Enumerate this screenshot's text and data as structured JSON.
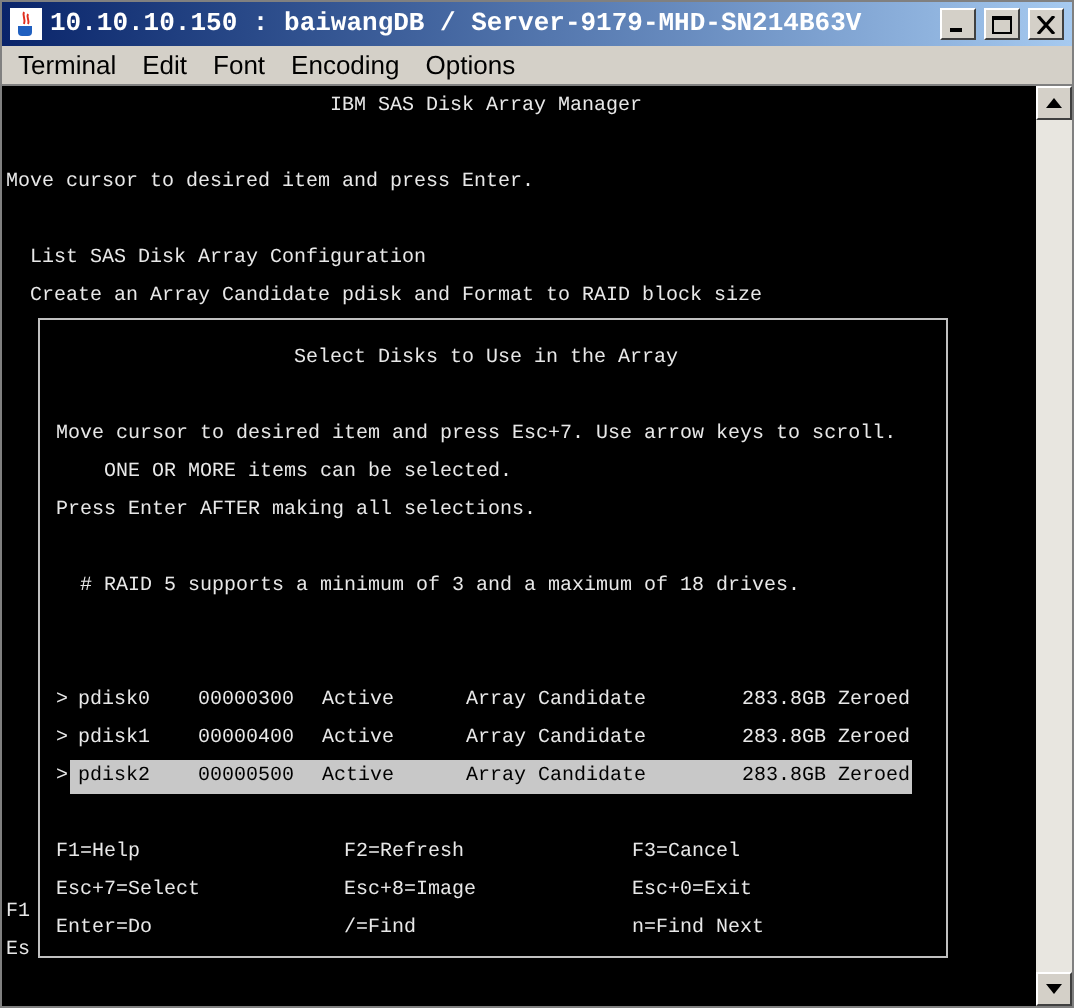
{
  "window": {
    "title": "10.10.10.150 : baiwangDB / Server-9179-MHD-SN214B63V"
  },
  "menu": [
    "Terminal",
    "Edit",
    "Font",
    "Encoding",
    "Options"
  ],
  "terminal": {
    "header": "IBM SAS Disk Array Manager",
    "instruction": "Move cursor to desired item and press Enter.",
    "items": [
      "List SAS Disk Array Configuration",
      "Create an Array Candidate pdisk and Format to RAID block size"
    ],
    "edge_text": [
      "F1",
      "Es"
    ]
  },
  "dialog": {
    "title": "Select Disks to Use in the Array",
    "instructions": [
      "Move cursor to desired item and press Esc+7. Use arrow keys to scroll.",
      "    ONE OR MORE items can be selected.",
      "Press Enter AFTER making all selections."
    ],
    "note": "# RAID 5 supports a minimum of 3 and a maximum of 18 drives.",
    "disks": [
      {
        "marker": ">",
        "name": "pdisk0",
        "location": "00000300",
        "status": "Active",
        "type": "Array Candidate",
        "size": "283.8GB Zeroed",
        "selected": false
      },
      {
        "marker": ">",
        "name": "pdisk1",
        "location": "00000400",
        "status": "Active",
        "type": "Array Candidate",
        "size": "283.8GB Zeroed",
        "selected": false
      },
      {
        "marker": ">",
        "name": "pdisk2",
        "location": "00000500",
        "status": "Active",
        "type": "Array Candidate",
        "size": "283.8GB Zeroed",
        "selected": true
      }
    ],
    "function_keys": [
      "F1=Help",
      "F2=Refresh",
      "F3=Cancel",
      "Esc+7=Select",
      "Esc+8=Image",
      "Esc+0=Exit",
      "Enter=Do",
      "/=Find",
      "n=Find Next"
    ]
  }
}
